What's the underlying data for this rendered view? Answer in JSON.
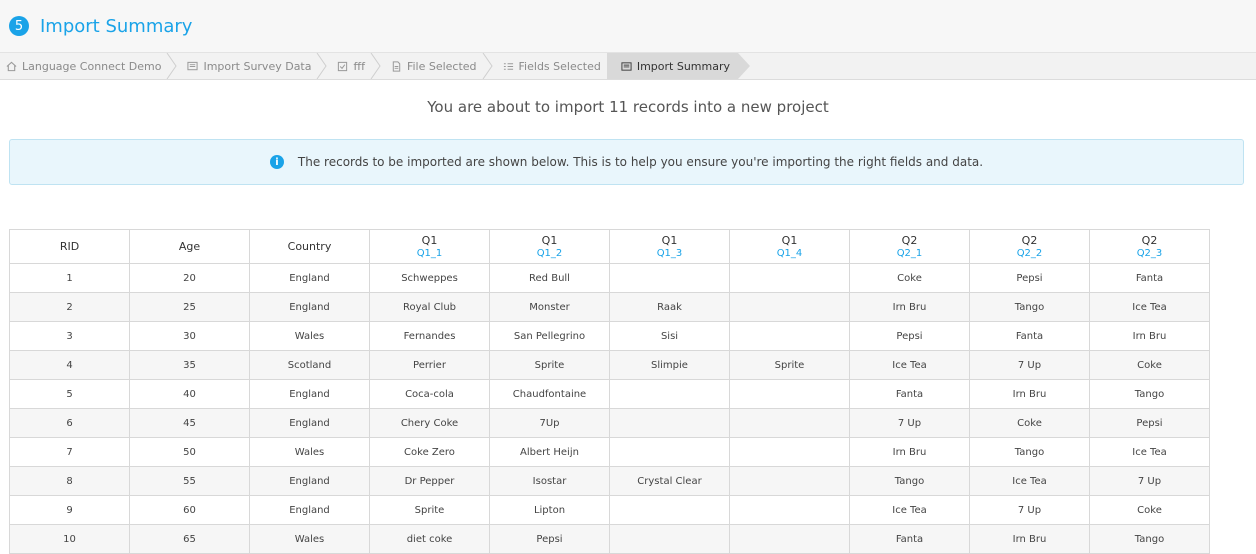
{
  "step_number": "5",
  "title": "Import Summary",
  "breadcrumbs": [
    {
      "label": "Language Connect Demo",
      "icon": "home-icon"
    },
    {
      "label": "Import Survey Data",
      "icon": "survey-icon"
    },
    {
      "label": "fff",
      "icon": "checkbox-icon"
    },
    {
      "label": "File Selected",
      "icon": "file-icon"
    },
    {
      "label": "Fields Selected",
      "icon": "fields-icon"
    },
    {
      "label": "Import Summary",
      "icon": "summary-icon"
    }
  ],
  "headline": "You are about to import 11 records into a new project",
  "info_message": "The records to be imported are shown below. This is to help you ensure you're importing the right fields and data.",
  "colors": {
    "accent": "#1aa3e8",
    "info_bg": "#e9f6fc"
  },
  "table": {
    "columns": [
      {
        "label": "RID",
        "sub": ""
      },
      {
        "label": "Age",
        "sub": ""
      },
      {
        "label": "Country",
        "sub": ""
      },
      {
        "label": "Q1",
        "sub": "Q1_1"
      },
      {
        "label": "Q1",
        "sub": "Q1_2"
      },
      {
        "label": "Q1",
        "sub": "Q1_3"
      },
      {
        "label": "Q1",
        "sub": "Q1_4"
      },
      {
        "label": "Q2",
        "sub": "Q2_1"
      },
      {
        "label": "Q2",
        "sub": "Q2_2"
      },
      {
        "label": "Q2",
        "sub": "Q2_3"
      }
    ],
    "rows": [
      [
        "1",
        "20",
        "England",
        "Schweppes",
        "Red Bull",
        "",
        "",
        "Coke",
        "Pepsi",
        "Fanta"
      ],
      [
        "2",
        "25",
        "England",
        "Royal Club",
        "Monster",
        "Raak",
        "",
        "Irn Bru",
        "Tango",
        "Ice Tea"
      ],
      [
        "3",
        "30",
        "Wales",
        "Fernandes",
        "San Pellegrino",
        "Sisi",
        "",
        "Pepsi",
        "Fanta",
        "Irn Bru"
      ],
      [
        "4",
        "35",
        "Scotland",
        "Perrier",
        "Sprite",
        "Slimpie",
        "Sprite",
        "Ice Tea",
        "7 Up",
        "Coke"
      ],
      [
        "5",
        "40",
        "England",
        "Coca-cola",
        "Chaudfontaine",
        "",
        "",
        "Fanta",
        "Irn Bru",
        "Tango"
      ],
      [
        "6",
        "45",
        "England",
        "Chery Coke",
        "7Up",
        "",
        "",
        "7 Up",
        "Coke",
        "Pepsi"
      ],
      [
        "7",
        "50",
        "Wales",
        "Coke Zero",
        "Albert Heijn",
        "",
        "",
        "Irn Bru",
        "Tango",
        "Ice Tea"
      ],
      [
        "8",
        "55",
        "England",
        "Dr Pepper",
        "Isostar",
        "Crystal Clear",
        "",
        "Tango",
        "Ice Tea",
        "7 Up"
      ],
      [
        "9",
        "60",
        "England",
        "Sprite",
        "Lipton",
        "",
        "",
        "Ice Tea",
        "7 Up",
        "Coke"
      ],
      [
        "10",
        "65",
        "Wales",
        "diet coke",
        "Pepsi",
        "",
        "",
        "Fanta",
        "Irn Bru",
        "Tango"
      ]
    ]
  }
}
